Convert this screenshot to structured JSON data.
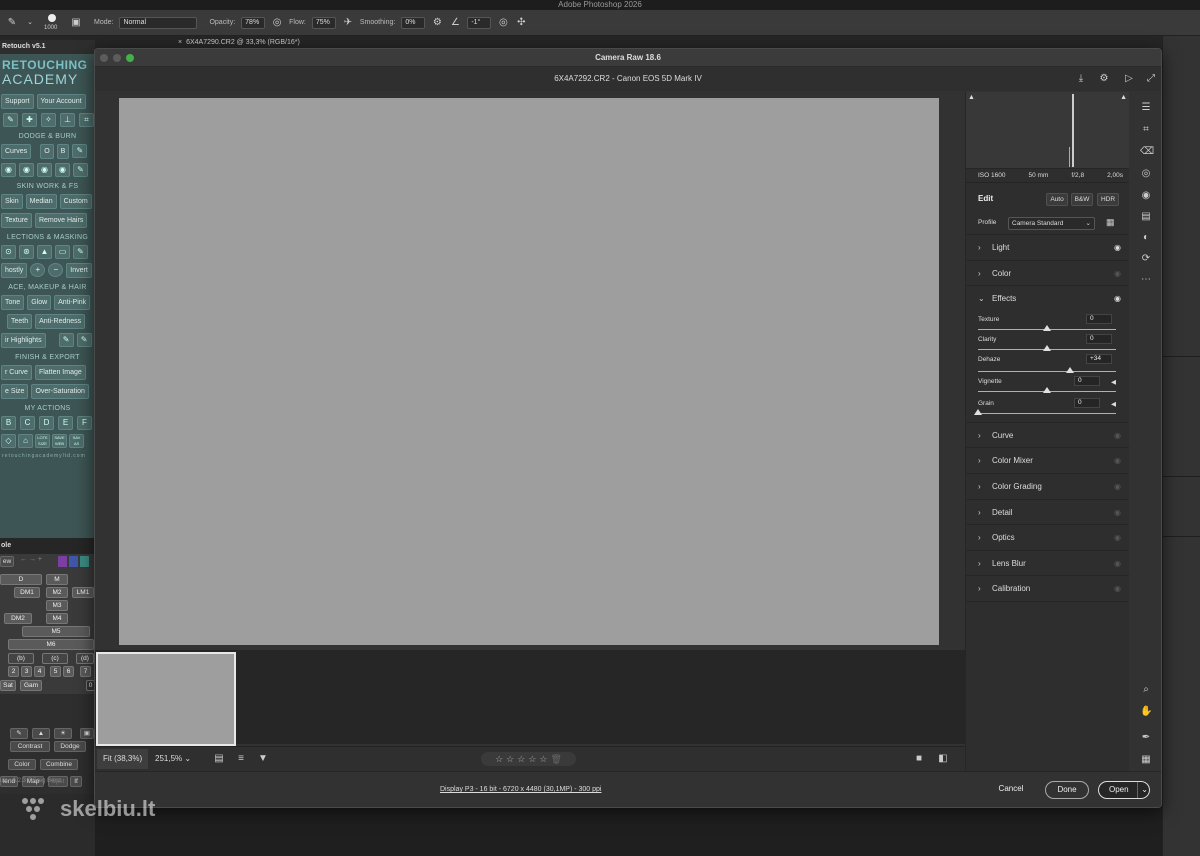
{
  "photoshop": {
    "app_title": "Adobe Photoshop 2026",
    "options_bar": {
      "brush_size": "1000",
      "mode_label": "Mode:",
      "mode_value": "Normal",
      "opacity_label": "Opacity:",
      "opacity_value": "78%",
      "flow_label": "Flow:",
      "flow_value": "75%",
      "smoothing_label": "Smoothing:",
      "smoothing_value": "0%",
      "angle_value": "-1°"
    },
    "document_tab": "6X4A7290.CR2 @ 33,3% (RGB/16*)"
  },
  "retouch_panel": {
    "header": "Retouch v5.1",
    "logo_line1": "RETOUCHING",
    "logo_line2": "ACADEMY",
    "support": "Support",
    "account": "Your Account",
    "dodge_burn": "DODGE & BURN",
    "curves": "Curves",
    "o": "O",
    "b": "B",
    "skin_work": "SKIN WORK & FS",
    "skin": "Skin",
    "median": "Median",
    "custom": "Custom",
    "texture": "Texture",
    "remove_hairs": "Remove Hairs",
    "selections": "LECTIONS & MASKING",
    "ghostly": "hostly",
    "invert": "Invert",
    "face_makeup": "ACE, MAKEUP & HAIR",
    "tone": "Tone",
    "glow": "Glow",
    "anti_pink": "Anti-Pink",
    "teeth": "Teeth",
    "anti_redness": "Anti-Redness",
    "hair_highlights": "ir Highlights",
    "finish_export": "FINISH & EXPORT",
    "curve": "r Curve",
    "flatten": "Flatten Image",
    "size": "e Size",
    "over_sat": "Over-Saturation",
    "my_actions": "MY ACTIONS",
    "actions": [
      "B",
      "C",
      "D",
      "E",
      "F"
    ],
    "small_labels": [
      "LOTE SIZE",
      "SAVE WEB",
      "SAV AS"
    ],
    "website": "retouchingacademyltd.com"
  },
  "combo_panel": {
    "title": "ole",
    "new_label": "ew",
    "keys": [
      "D",
      "M",
      "DM1",
      "M2",
      "LM1",
      "M3",
      "DM2",
      "M4",
      "M5",
      "M6",
      "(b)",
      "(c)",
      "(d)",
      "2",
      "3",
      "4",
      "5",
      "6",
      "7",
      "Sat",
      "Gam",
      "0"
    ],
    "buttons": [
      "Contrast",
      "Dodge",
      "Color",
      "Combine",
      "lend",
      "Map",
      "Split",
      "If"
    ],
    "credit": "ula v6.2.3 ©Greg Benz"
  },
  "camera_raw": {
    "title": "Camera Raw 18.6",
    "file_info": "6X4A7292.CR2  -  Canon EOS 5D Mark IV",
    "metadata": [
      "ISO 1600",
      "50 mm",
      "f/2,8",
      "2,00s"
    ],
    "edit_label": "Edit",
    "auto": "Auto",
    "bw": "B&W",
    "hdr": "HDR",
    "profile_label": "Profile",
    "profile_value": "Camera Standard",
    "sections_top": [
      {
        "name": "Light",
        "eye": true
      },
      {
        "name": "Color",
        "eye": false
      }
    ],
    "effects": {
      "name": "Effects",
      "texture": {
        "label": "Texture",
        "value": "0"
      },
      "clarity": {
        "label": "Clarity",
        "value": "0"
      },
      "dehaze": {
        "label": "Dehaze",
        "value": "+34"
      },
      "vignette": {
        "label": "Vignette",
        "value": "0"
      },
      "grain": {
        "label": "Grain",
        "value": "0"
      }
    },
    "sections_bottom": [
      "Curve",
      "Color Mixer",
      "Color Grading",
      "Detail",
      "Optics",
      "Lens Blur",
      "Calibration"
    ],
    "fit_label": "Fit (38,3%)",
    "zoom_label": "251,5%",
    "footer_info": "Display P3 - 16 bit - 6720 x 4480 (30,1MP) - 300 ppi",
    "cancel": "Cancel",
    "done": "Done",
    "open": "Open",
    "rating_stars": 5
  },
  "watermark": "skelbiu.lt"
}
